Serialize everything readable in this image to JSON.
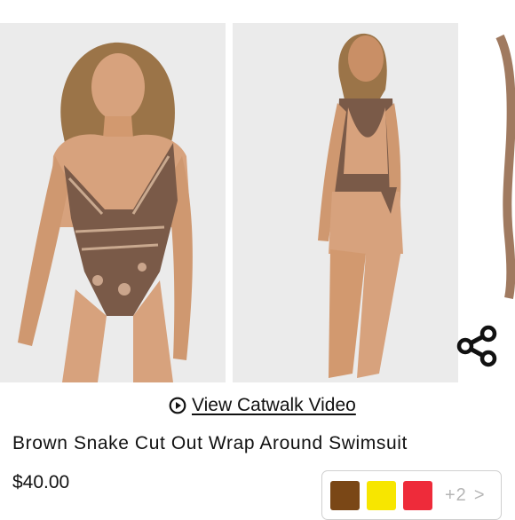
{
  "gallery": {
    "images": [
      {
        "alt": "snakeskin cut out wrap swimsuit front view"
      },
      {
        "alt": "snakeskin cut out wrap swimsuit back view"
      },
      {
        "alt": "swimsuit partial view"
      }
    ]
  },
  "share": {
    "icon": "share-icon"
  },
  "video": {
    "label": "View Catwalk Video",
    "icon": "play-circle-icon"
  },
  "product": {
    "title": "Brown Snake Cut Out Wrap Around Swimsuit",
    "price": "$40.00"
  },
  "colors": {
    "swatches": [
      {
        "name": "brown",
        "color": "#7a4716"
      },
      {
        "name": "yellow",
        "color": "#f7e600"
      },
      {
        "name": "red",
        "color": "#ee2b3a"
      }
    ],
    "more_label": "+2",
    "chevron": ">"
  },
  "theme": {
    "text": "#111111",
    "photo_bg": "#e9e9e9",
    "skin": "#d8a27a",
    "snake": "#7a5a48"
  }
}
